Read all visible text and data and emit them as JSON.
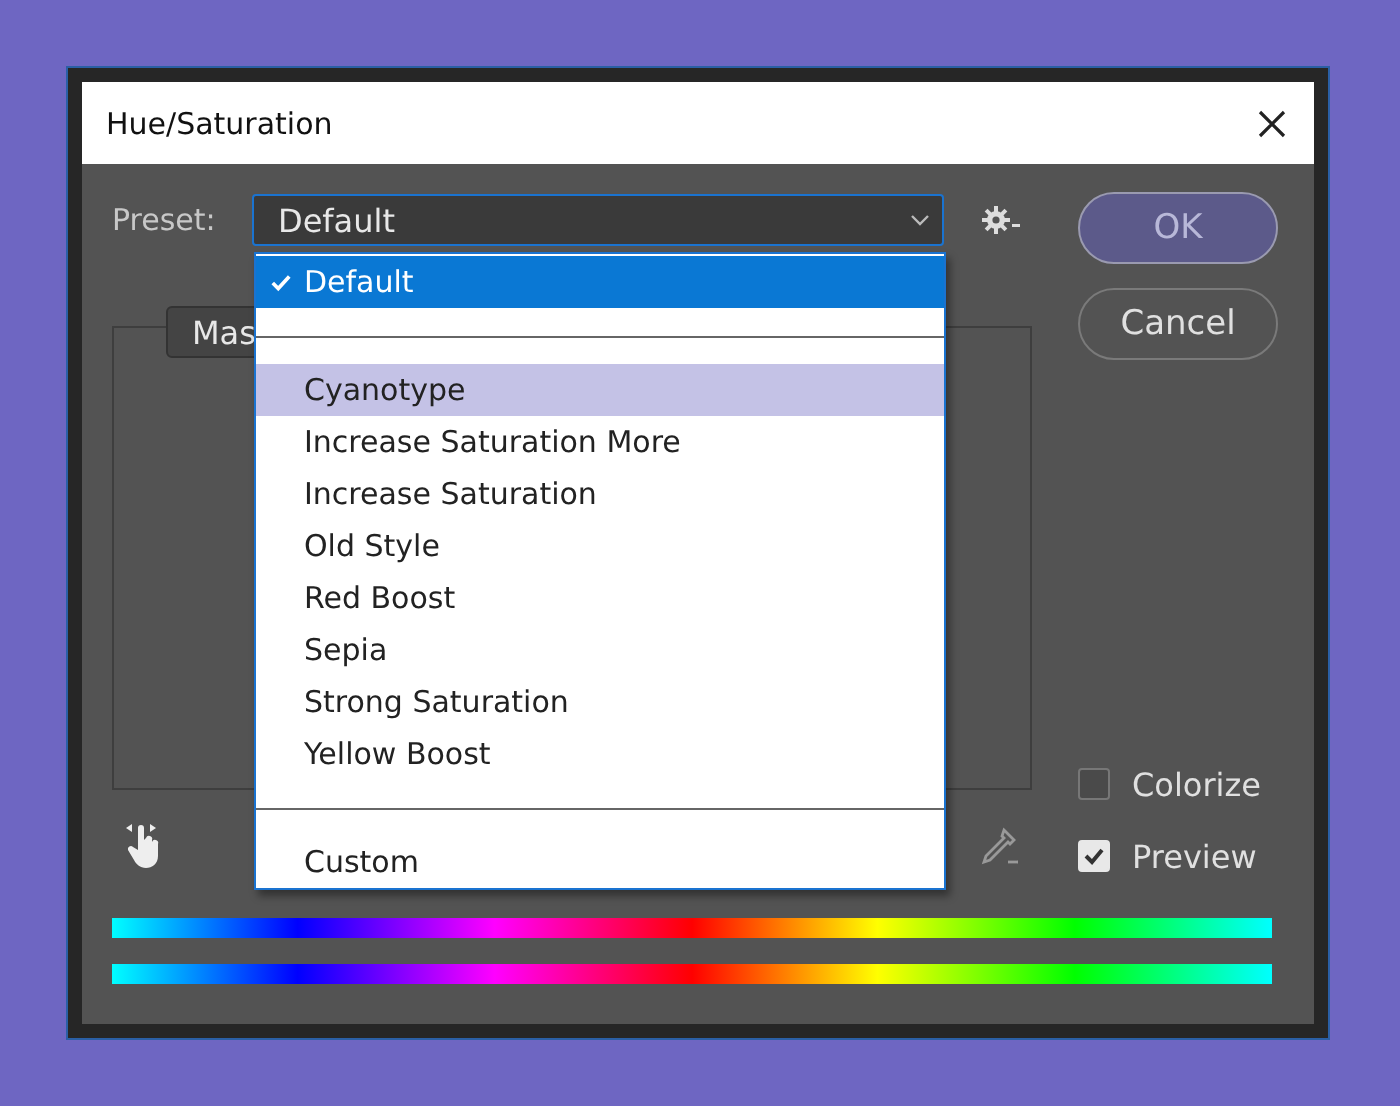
{
  "window": {
    "title": "Hue/Saturation"
  },
  "preset": {
    "label": "Preset:",
    "value": "Default"
  },
  "menu": [
    {
      "kind": "item",
      "label": "Default",
      "checked": true,
      "selected": true,
      "highlighted": false
    },
    {
      "kind": "separator"
    },
    {
      "kind": "item",
      "label": "Cyanotype",
      "checked": false,
      "selected": false,
      "highlighted": true
    },
    {
      "kind": "item",
      "label": "Increase Saturation More",
      "checked": false,
      "selected": false,
      "highlighted": false
    },
    {
      "kind": "item",
      "label": "Increase Saturation",
      "checked": false,
      "selected": false,
      "highlighted": false
    },
    {
      "kind": "item",
      "label": "Old Style",
      "checked": false,
      "selected": false,
      "highlighted": false
    },
    {
      "kind": "item",
      "label": "Red Boost",
      "checked": false,
      "selected": false,
      "highlighted": false
    },
    {
      "kind": "item",
      "label": "Sepia",
      "checked": false,
      "selected": false,
      "highlighted": false
    },
    {
      "kind": "item",
      "label": "Strong Saturation",
      "checked": false,
      "selected": false,
      "highlighted": false
    },
    {
      "kind": "item",
      "label": "Yellow Boost",
      "checked": false,
      "selected": false,
      "highlighted": false
    },
    {
      "kind": "separator"
    },
    {
      "kind": "item",
      "label": "Custom",
      "checked": false,
      "selected": false,
      "highlighted": false
    }
  ],
  "panel": {
    "tab": "Mas"
  },
  "buttons": [
    {
      "label": "OK",
      "default": true
    },
    {
      "label": "Cancel",
      "default": false
    }
  ],
  "options": [
    {
      "label": "Colorize",
      "checked": false
    },
    {
      "label": "Preview",
      "checked": true
    }
  ]
}
